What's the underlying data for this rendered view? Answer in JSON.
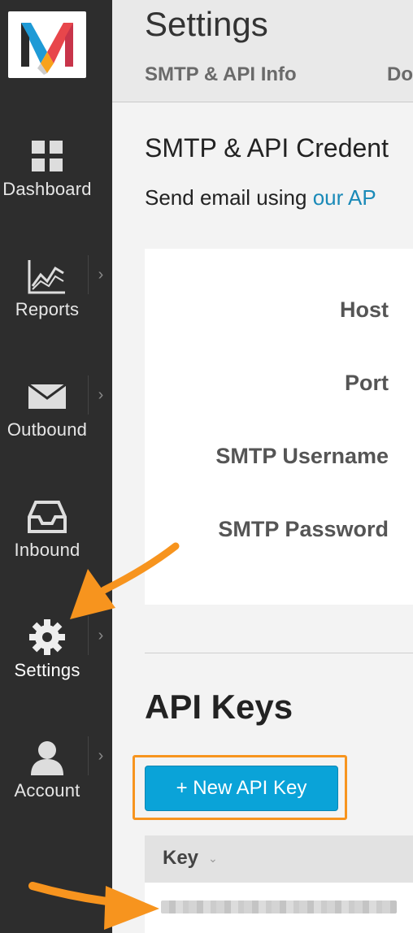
{
  "sidebar": {
    "logo_letter": "M",
    "items": [
      {
        "label": "Dashboard",
        "icon": "dashboard-grid-icon",
        "has_submenu": false
      },
      {
        "label": "Reports",
        "icon": "reports-chart-icon",
        "has_submenu": true
      },
      {
        "label": "Outbound",
        "icon": "envelope-icon",
        "has_submenu": true
      },
      {
        "label": "Inbound",
        "icon": "inbox-tray-icon",
        "has_submenu": false
      },
      {
        "label": "Settings",
        "icon": "gear-icon",
        "has_submenu": true
      },
      {
        "label": "Account",
        "icon": "user-icon",
        "has_submenu": true
      }
    ],
    "submenu_glyph": "›"
  },
  "header": {
    "title": "Settings",
    "tabs": [
      "SMTP & API Info",
      "Do"
    ]
  },
  "credentials": {
    "heading": "SMTP & API Credent",
    "description_prefix": "Send email using ",
    "description_link": "our AP",
    "fields": [
      "Host",
      "Port",
      "SMTP Username",
      "SMTP Password"
    ]
  },
  "api_keys": {
    "heading": "API Keys",
    "new_button_label": "+ New API Key",
    "table": {
      "columns": [
        "Key"
      ],
      "sort_glyph": "⌄"
    }
  },
  "colors": {
    "sidebar_bg": "#2d2d2d",
    "accent_blue": "#0aa3d8",
    "link_blue": "#1a8ab8",
    "annotation_orange": "#f7941e"
  }
}
